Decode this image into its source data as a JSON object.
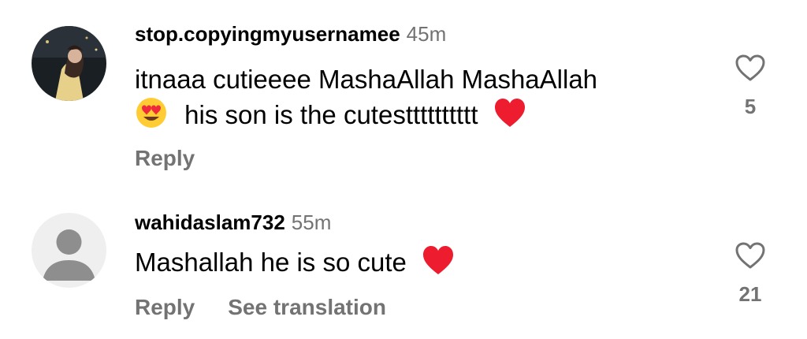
{
  "comments": [
    {
      "username": "stop.copyingmyusernamee",
      "time": "45m",
      "text_line1": "itnaaa cutieeee MashaAllah MashaAllah",
      "text_line2": "his son is the cutestttttttttt",
      "leading_emoji": "heart-eyes-emoji",
      "trailing_emoji": "red-heart-emoji",
      "reply_label": "Reply",
      "like_count": "5",
      "avatar": "photo-avatar"
    },
    {
      "username": "wahidaslam732",
      "time": "55m",
      "text_line1": "Mashallah he is so cute",
      "trailing_emoji": "red-heart-emoji",
      "reply_label": "Reply",
      "translate_label": "See translation",
      "like_count": "21",
      "avatar": "default-avatar"
    }
  ],
  "colors": {
    "text": "#000000",
    "secondary": "#737373",
    "heart_red": "#ED1C2E",
    "default_avatar_bg": "#EFEFEF",
    "default_avatar_figure": "#8E8E8E"
  }
}
